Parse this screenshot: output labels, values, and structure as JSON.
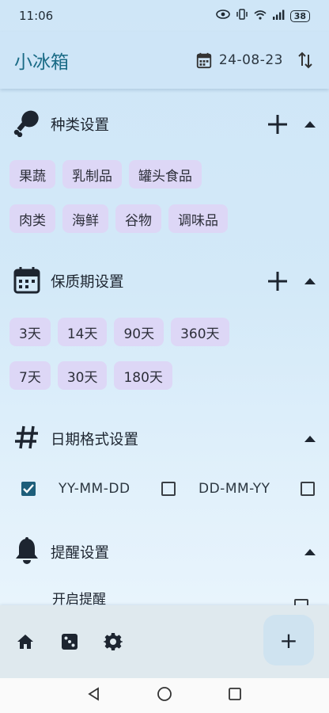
{
  "status_bar": {
    "time": "11:06",
    "battery": "38"
  },
  "app_bar": {
    "title": "小冰箱",
    "date": "24-08-23"
  },
  "sections": {
    "category": {
      "title": "种类设置",
      "rows": [
        [
          "果蔬",
          "乳制品",
          "罐头食品"
        ],
        [
          "肉类",
          "海鲜",
          "谷物",
          "调味品"
        ]
      ]
    },
    "shelf_life": {
      "title": "保质期设置",
      "rows": [
        [
          "3天",
          "14天",
          "90天",
          "360天"
        ],
        [
          "7天",
          "30天",
          "180天"
        ]
      ]
    },
    "date_format": {
      "title": "日期格式设置",
      "options": [
        {
          "label": "YY-MM-DD",
          "checked": true
        },
        {
          "label": "DD-MM-YY",
          "checked": false
        },
        {
          "label": "",
          "checked": false
        }
      ]
    },
    "reminder": {
      "title": "提醒设置",
      "enable_label": "开启提醒",
      "enable_checked": false
    }
  },
  "fab": {
    "label": "+"
  },
  "colors": {
    "accent": "#1a6b86",
    "chip": "#ddd7f6",
    "checkbox_checked": "#1d5e7a"
  }
}
